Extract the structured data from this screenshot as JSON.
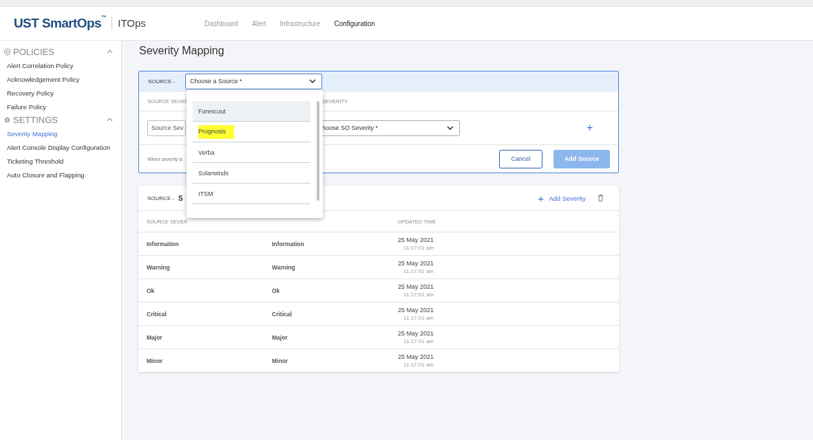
{
  "header": {
    "logo": "UST SmartOps",
    "trademark": "™",
    "product": "ITOps",
    "nav": [
      {
        "label": "Dashboard",
        "selected": false
      },
      {
        "label": "Alert",
        "selected": false
      },
      {
        "label": "Infrastructure",
        "selected": false
      },
      {
        "label": "Configuration",
        "selected": true
      }
    ]
  },
  "sidebar": {
    "sections": [
      {
        "title": "POLICIES",
        "kind": "shield",
        "expanded": true,
        "items": [
          {
            "label": "Alert Correlation Policy",
            "selected": false
          },
          {
            "label": "Acknowledgement Policy",
            "selected": false
          },
          {
            "label": "Recovery Policy",
            "selected": false
          },
          {
            "label": "Failure Policy",
            "selected": false
          }
        ]
      },
      {
        "title": "SETTINGS",
        "kind": "gear",
        "expanded": true,
        "items": [
          {
            "label": "Severity Mapping",
            "selected": true
          },
          {
            "label": "Alert Console Display Configuration",
            "selected": false
          },
          {
            "label": "Ticketing Threshold",
            "selected": false
          },
          {
            "label": "Auto Closure and Flapping",
            "selected": false
          }
        ]
      }
    ]
  },
  "page_title": "Severity Mapping",
  "add_card": {
    "source_label": "SOURCE -",
    "source_select": {
      "placeholder": "Choose a Source *"
    },
    "column_1": "SOURCE SEVER",
    "column_2": "SEVERITY",
    "source_severity_field": {
      "placeholder": "Source Sev"
    },
    "so_severity_select": {
      "placeholder": "hoose SO Severity *"
    },
    "add_icon": "+",
    "note": "When severity is",
    "buttons": [
      {
        "label": "Cancel",
        "kind": "secondary",
        "disabled": false
      },
      {
        "label": "Add Source",
        "kind": "primary",
        "disabled": true
      }
    ]
  },
  "dropdown": {
    "options": [
      {
        "label": "Forescout",
        "selected": true,
        "highlighted": false
      },
      {
        "label": "Prognosis",
        "selected": false,
        "highlighted": true
      },
      {
        "label": "Verba",
        "selected": false,
        "highlighted": false
      },
      {
        "label": "Solarwinds",
        "selected": false,
        "highlighted": false
      },
      {
        "label": "ITSM",
        "selected": false,
        "highlighted": false
      }
    ]
  },
  "mapping_card": {
    "source_label": "SOURCE -",
    "source_name": "S",
    "add_icon": "+",
    "add_severity": "Add Severity",
    "column_1": "SOURCE SEVER",
    "column_3": "UPDATED TIME",
    "rows": [
      {
        "source_severity": "Information",
        "so_severity": "Information",
        "date": "25 May 2021",
        "time": "11:17:01 am"
      },
      {
        "source_severity": "Warning",
        "so_severity": "Warning",
        "date": "25 May 2021",
        "time": "11:17:01 am"
      },
      {
        "source_severity": "Ok",
        "so_severity": "Ok",
        "date": "25 May 2021",
        "time": "11:17:01 am"
      },
      {
        "source_severity": "Critical",
        "so_severity": "Critical",
        "date": "25 May 2021",
        "time": "11:17:01 am"
      },
      {
        "source_severity": "Major",
        "so_severity": "Major",
        "date": "25 May 2021",
        "time": "11:17:01 am"
      },
      {
        "source_severity": "Minor",
        "so_severity": "Minor",
        "date": "25 May 2021",
        "time": "11:17:01 am"
      }
    ]
  }
}
